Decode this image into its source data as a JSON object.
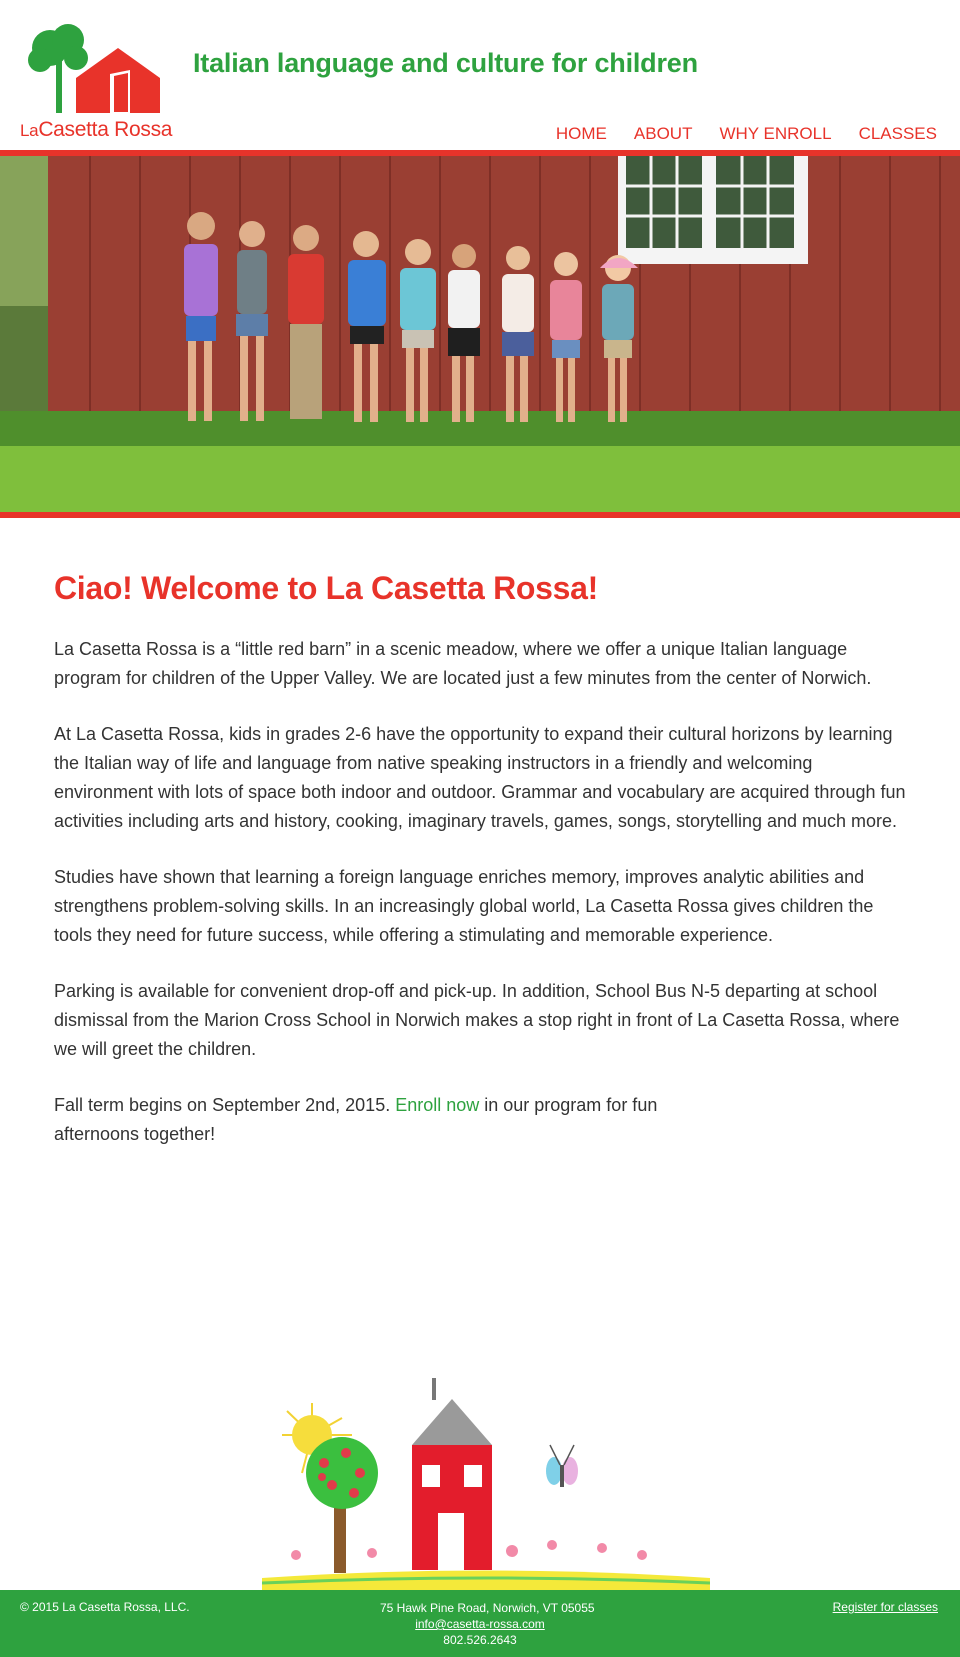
{
  "brand": {
    "logo_text_small": "La",
    "logo_text_main": "Casetta Rossa",
    "tagline": "Italian language and culture for children"
  },
  "nav": {
    "items": [
      {
        "label": "HOME",
        "active": true
      },
      {
        "label": "ABOUT",
        "active": false
      },
      {
        "label": "WHY ENROLL",
        "active": false
      },
      {
        "label": "CLASSES",
        "active": false
      }
    ]
  },
  "main": {
    "title": "Ciao! Welcome to La Casetta Rossa!",
    "paragraphs": [
      "La Casetta Rossa is a “little red barn” in a scenic meadow, where we offer a unique Italian language program for children of the Upper Valley. We are located just a few minutes from the center of Norwich.",
      "At La Casetta Rossa, kids in grades 2-6 have the opportunity to expand their cultural horizons by learning the Italian way of life and language from native speaking instructors in a friendly and welcoming environment with lots of space both indoor and outdoor. Grammar and vocabulary are acquired through fun activities including arts and history, cooking, imaginary travels, games, songs, storytelling and much more.",
      "Studies have shown that learning a foreign language enriches memory, improves analytic abilities and strengthens problem-solving skills. In an increasingly global world, La Casetta Rossa gives children the tools they need for future success, while offering a stimulating and memorable experience.",
      "Parking is available for convenient drop-off and pick-up. In addition, School Bus N-5 departing at school dismissal from the Marion Cross School in Norwich makes a stop right in front of La Casetta Rossa, where we will greet the children."
    ],
    "last_paragraph": {
      "before": "Fall term begins on September 2nd, 2015. ",
      "link": "Enroll now",
      "after": " in our program for fun afternoons together!"
    }
  },
  "footer": {
    "copyright": "© 2015 La Casetta Rossa, LLC.",
    "address": "75 Hawk Pine Road, Norwich, VT 05055",
    "email": "info@casetta-rossa.com",
    "phone": "802.526.2643",
    "register_link": "Register for classes"
  },
  "colors": {
    "brand_red": "#e8332a",
    "brand_green": "#2ea23f",
    "body_text": "#333333"
  }
}
